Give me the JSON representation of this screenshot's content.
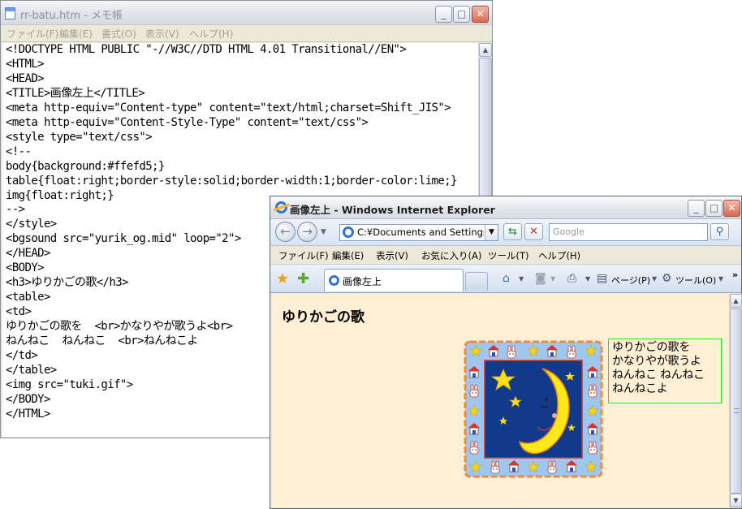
{
  "notepad": {
    "title": "rr-batu.htm - メモ帳",
    "menu": [
      "ファイル(F)",
      "編集(E)",
      "書式(O)",
      "表示(V)",
      "ヘルプ(H)"
    ],
    "lines": [
      "<!DOCTYPE HTML PUBLIC \"-//W3C//DTD HTML 4.01 Transitional//EN\">",
      "<HTML>",
      "<HEAD>",
      "<TITLE>画像左上</TITLE>",
      "<meta http-equiv=\"Content-type\" content=\"text/html;charset=Shift_JIS\">",
      "<meta http-equiv=\"Content-Style-Type\" content=\"text/css\">",
      "<style type=\"text/css\">",
      "<!--",
      "body{background:#ffefd5;}",
      "table{float:right;border-style:solid;border-width:1;border-color:lime;}",
      "img{float:right;}",
      "-->",
      "</style>",
      "<bgsound src=\"yurik_og.mid\" loop=\"2\">",
      "</HEAD>",
      "<BODY>",
      "<h3>ゆりかごの歌</h3>",
      "<table>",
      "<td>",
      "ゆりかごの歌を  <br>かなりやが歌うよ<br>",
      "ねんねこ  ねんねこ  <br>ねんねこよ",
      "</td>",
      "</table>",
      "<img src=\"tuki.gif\">",
      "</BODY>",
      "</HTML>"
    ]
  },
  "ie": {
    "title": "画像左上 - Windows Internet Explorer",
    "address": "C:¥Documents and Settings¥hi",
    "search_placeholder": "Google",
    "menu": [
      "ファイル(F)",
      "編集(E)",
      "表示(V)",
      "お気に入り(A)",
      "ツール(T)",
      "ヘルプ(H)"
    ],
    "tab_label": "画像左上",
    "toolbar_page": "ページ(P)",
    "toolbar_tools": "ツール(O)",
    "page": {
      "heading": "ゆりかごの歌",
      "poem": [
        "ゆりかごの歌を",
        "かなりやが歌うよ",
        "ねんねこ  ねんねこ",
        "ねんねこよ"
      ],
      "background": "#ffefd5",
      "table_border_color": "#00ff00"
    }
  },
  "icons": {
    "minimize": "minimize-icon",
    "maximize": "maximize-icon",
    "close": "close-icon",
    "back": "back-icon",
    "forward": "forward-icon",
    "refresh": "refresh-icon",
    "stop": "stop-icon",
    "search": "search-icon",
    "favorites": "star-icon",
    "home": "home-icon",
    "feeds": "rss-icon",
    "print": "print-icon",
    "gear": "gear-icon",
    "moon": "moon-icon"
  }
}
